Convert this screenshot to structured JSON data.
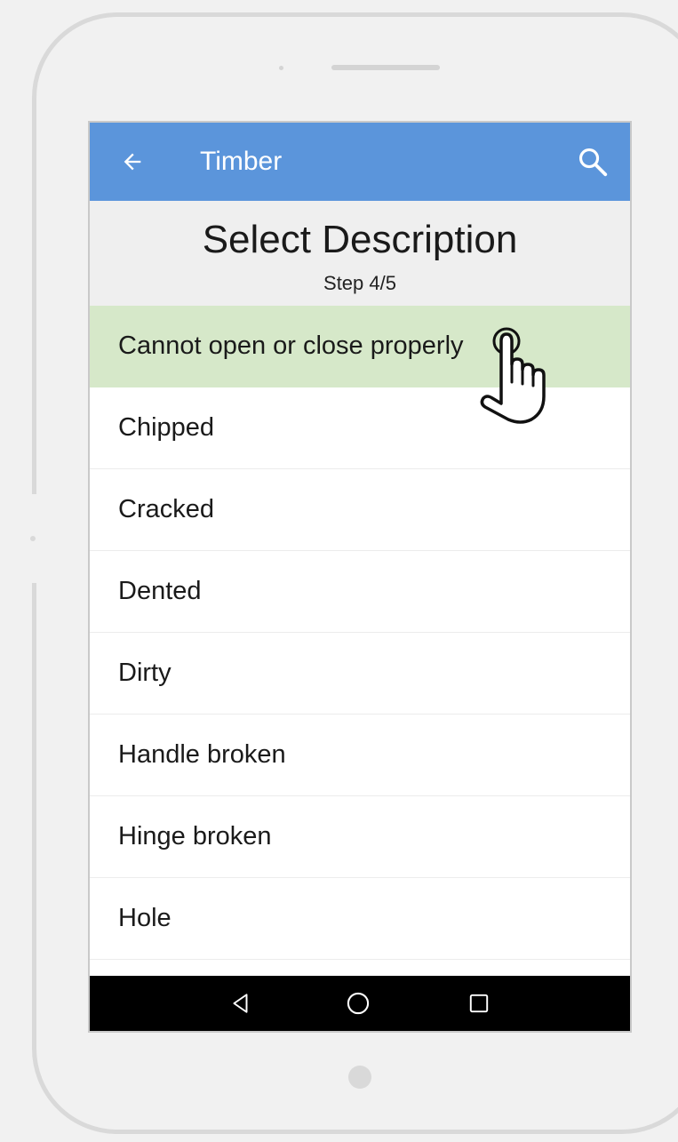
{
  "app": {
    "title": "Timber",
    "accent_color": "#5b95db",
    "back_icon": "arrow-left-icon",
    "search_icon": "search-icon"
  },
  "step": {
    "title": "Select Description",
    "subtitle": "Step 4/5"
  },
  "descriptions": {
    "items": [
      {
        "label": "Cannot open or close properly",
        "selected": true
      },
      {
        "label": "Chipped",
        "selected": false
      },
      {
        "label": "Cracked",
        "selected": false
      },
      {
        "label": "Dented",
        "selected": false
      },
      {
        "label": "Dirty",
        "selected": false
      },
      {
        "label": "Handle broken",
        "selected": false
      },
      {
        "label": "Hinge broken",
        "selected": false
      },
      {
        "label": "Hole",
        "selected": false
      }
    ],
    "selected_color": "#d6e8c9"
  },
  "navbar": {
    "back_icon": "triangle-back-icon",
    "home_icon": "circle-home-icon",
    "recents_icon": "square-recents-icon"
  },
  "overlay": {
    "pointer_icon": "hand-pointer-icon"
  }
}
